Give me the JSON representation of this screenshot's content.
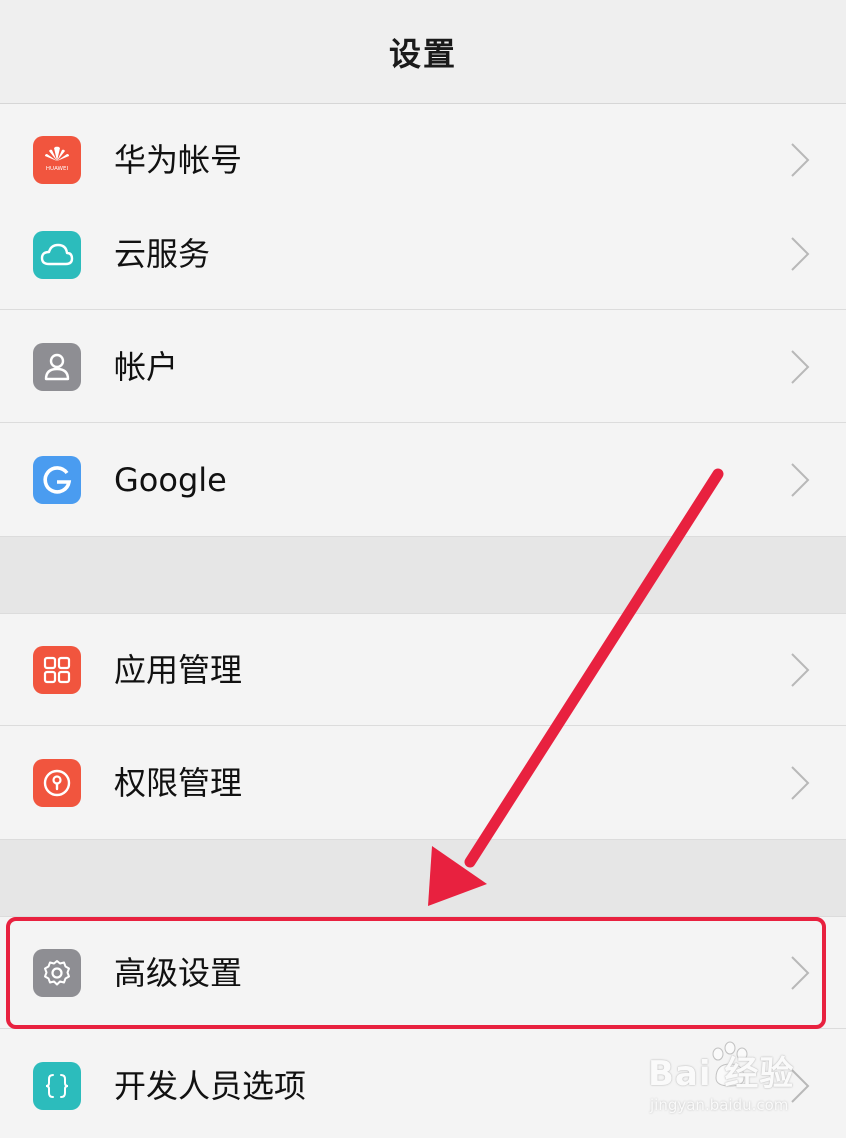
{
  "header": {
    "title": "设置"
  },
  "group1": [
    {
      "label": "华为帐号",
      "icon": "huawei-logo-icon",
      "color": "#f1553e"
    },
    {
      "label": "云服务",
      "icon": "cloud-icon",
      "color": "#2cbcbc"
    },
    {
      "label": "帐户",
      "icon": "user-icon",
      "color": "#8e8e93"
    },
    {
      "label": "Google",
      "icon": "google-g-icon",
      "color": "#4a9cf0"
    }
  ],
  "group2": [
    {
      "label": "应用管理",
      "icon": "app-grid-icon",
      "color": "#f1553e"
    },
    {
      "label": "权限管理",
      "icon": "keyhole-icon",
      "color": "#f1553e"
    }
  ],
  "group3": [
    {
      "label": "高级设置",
      "icon": "gear-icon",
      "color": "#8e8e93"
    },
    {
      "label": "开发人员选项",
      "icon": "braces-icon",
      "color": "#2cbcbc"
    }
  ],
  "overlay": {
    "highlight_color": "#e8213f",
    "arrow_color": "#e8213f"
  },
  "watermark": {
    "main": "Bai  经验",
    "sub": "jingyan.baidu.com"
  }
}
